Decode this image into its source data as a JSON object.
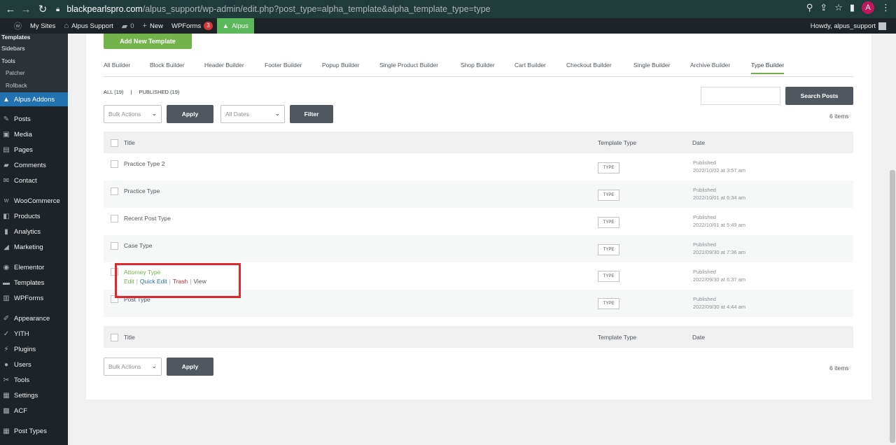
{
  "browser": {
    "url_host": "blackpearlspro.com",
    "url_path": "/alpus_support/wp-admin/edit.php?post_type=alpha_template&alpha_template_type=type",
    "profile_initial": "A"
  },
  "admin_bar": {
    "my_sites": "My Sites",
    "site_name": "Alpus Support",
    "comments_count": "0",
    "new_label": "New",
    "wpforms_label": "WPForms",
    "wpforms_badge": "3",
    "alpus_label": "Alpus",
    "howdy": "Howdy, alpus_support"
  },
  "sidebar": {
    "submenu": [
      "Templates",
      "Sidebars",
      "Tools",
      "Patcher",
      "Rollback"
    ],
    "active": "Alpus Addons",
    "items_group1": [
      "Posts",
      "Media",
      "Pages",
      "Comments",
      "Contact"
    ],
    "items_group2": [
      "WooCommerce",
      "Products",
      "Analytics",
      "Marketing"
    ],
    "items_group3": [
      "Elementor",
      "Templates",
      "WPForms"
    ],
    "items_group4": [
      "Appearance",
      "YITH",
      "Plugins",
      "Users",
      "Tools",
      "Settings",
      "ACF"
    ],
    "items_group5": [
      "Post Types"
    ]
  },
  "page": {
    "add_new": "Add New Template",
    "tabs": [
      "All Builder",
      "Block Builder",
      "Header Builder",
      "Footer Builder",
      "Popup Builder",
      "Single Product Builder",
      "Shop Builder",
      "Cart Builder",
      "Checkout Builder",
      "Single Builder",
      "Archive Builder",
      "Type Builder"
    ],
    "active_tab": "Type Builder",
    "filter_all": "ALL (19)",
    "filter_sep": "|",
    "filter_published": "PUBLISHED (19)",
    "search_button": "Search Posts",
    "bulk_actions": "Bulk Actions",
    "apply": "Apply",
    "all_dates": "All Dates",
    "filter": "Filter",
    "items_count": "6 items"
  },
  "table": {
    "col_title": "Title",
    "col_type": "Template Type",
    "col_date": "Date",
    "type_badge": "TYPE",
    "rows": [
      {
        "title": "Practice Type 2",
        "status": "Published",
        "date": "2022/10/02 at 3:57 am"
      },
      {
        "title": "Practice Type",
        "status": "Published",
        "date": "2022/10/01 at 6:34 am"
      },
      {
        "title": "Recent Post Type",
        "status": "Published",
        "date": "2022/10/01 at 5:49 am"
      },
      {
        "title": "Case Type",
        "status": "Published",
        "date": "2022/09/30 at 7:36 am"
      },
      {
        "title": "Attorney Type",
        "status": "Published",
        "date": "2022/09/30 at 6:37 am"
      },
      {
        "title": "Post Type",
        "status": "Published",
        "date": "2022/09/30 at 4:44 am"
      }
    ],
    "row_actions": {
      "edit": "Edit",
      "quick_edit": "Quick Edit",
      "trash": "Trash",
      "view": "View",
      "sep": "|"
    }
  },
  "colors": {
    "accent_green": "#72b34c",
    "admin_dark": "#1d2327",
    "active_blue": "#2271b1",
    "highlight_red": "#e3262e"
  }
}
